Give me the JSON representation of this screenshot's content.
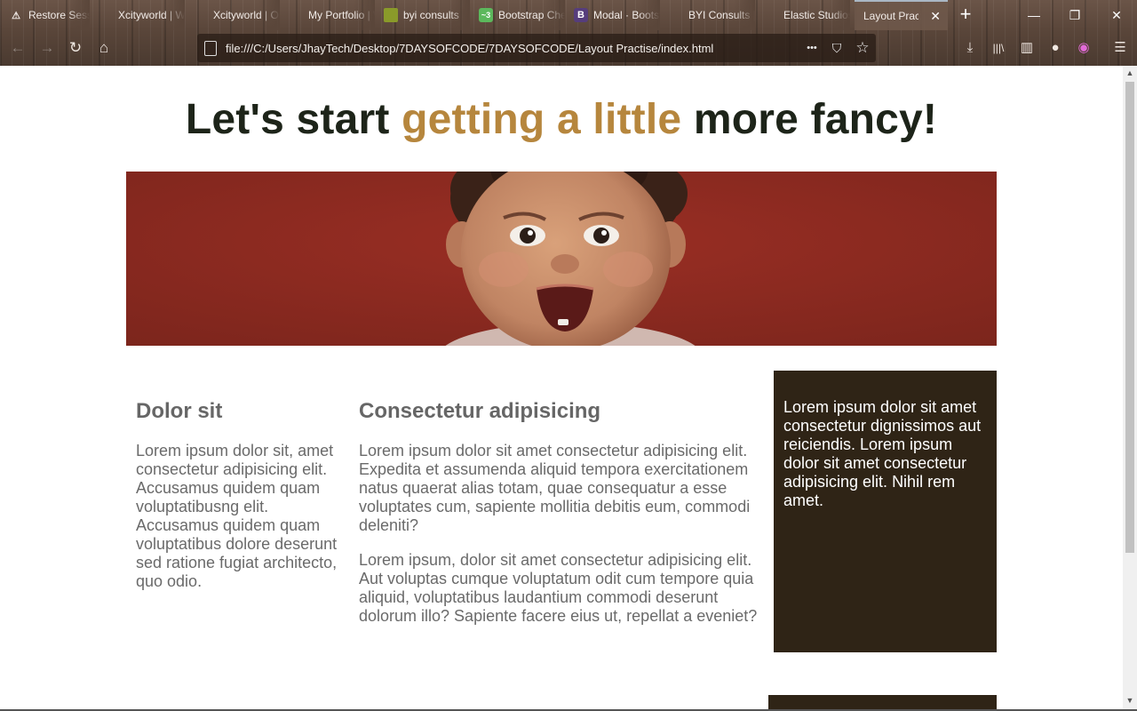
{
  "browser": {
    "tabs": [
      {
        "label": "Restore Session",
        "icon": "warning-icon",
        "active": false
      },
      {
        "label": "Xcityworld | Web",
        "icon": "",
        "active": false
      },
      {
        "label": "Xcityworld | Our",
        "icon": "",
        "active": false
      },
      {
        "label": "My Portfolio | Web",
        "icon": "",
        "active": false
      },
      {
        "label": "byi consults",
        "icon": "site-icon",
        "active": false
      },
      {
        "label": "Bootstrap Cheat",
        "icon": "bootstrap-icon",
        "active": false
      },
      {
        "label": "Modal · Bootstrap",
        "icon": "bootstrap-b-icon",
        "active": false
      },
      {
        "label": "BYI Consults | Home",
        "icon": "",
        "active": false
      },
      {
        "label": "Elastic Studios",
        "icon": "",
        "active": false
      },
      {
        "label": "Layout Practise",
        "icon": "",
        "active": true
      }
    ],
    "url": "file:///C:/Users/JhayTech/Desktop/7DAYSOFCODE/7DAYSOFCODE/Layout Practise/index.html",
    "icons": {
      "new_tab": "+",
      "minimize": "—",
      "restore": "❐",
      "close": "✕",
      "back": "←",
      "forward": "→",
      "reload": "↻",
      "home": "⌂",
      "more": "•••",
      "pocket": "⛉",
      "star": "☆",
      "download": "⤓",
      "library": "|||\\",
      "sidebar": "▥",
      "account": "●",
      "color": "◉",
      "menu": "☰"
    }
  },
  "page": {
    "title_pre": "Let's start ",
    "title_accent": "getting a little",
    "title_post": " more fancy!",
    "col1": {
      "heading": "Dolor sit",
      "para": "Lorem ipsum dolor sit, amet consectetur adipisicing elit. Accusamus quidem quam voluptatibusng elit. Accusamus quidem quam voluptatibus dolore deserunt sed ratione fugiat architecto, quo odio."
    },
    "col2": {
      "heading": "Consectetur adipisicing",
      "para1": "Lorem ipsum dolor sit amet consectetur adipisicing elit. Expedita et assumenda aliquid tempora exercitationem natus quaerat alias totam, quae consequatur a esse voluptates cum, sapiente mollitia debitis eum, commodi deleniti?",
      "para2": "Lorem ipsum, dolor sit amet consectetur adipisicing elit. Aut voluptas cumque voluptatum odit cum tempore quia aliquid, voluptatibus laudantium commodi deserunt dolorum illo? Sapiente facere eius ut, repellat a eveniet?"
    },
    "sidebox": "Lorem ipsum dolor sit amet consectetur dignissimos aut reiciendis. Lorem ipsum dolor sit amet consectetur adipisicing elit. Nihil rem amet."
  },
  "colors": {
    "title": "#1d2419",
    "accent": "#b6863d",
    "sidebox_bg": "#2f2416",
    "hero_bg": "#8a2a1f"
  }
}
